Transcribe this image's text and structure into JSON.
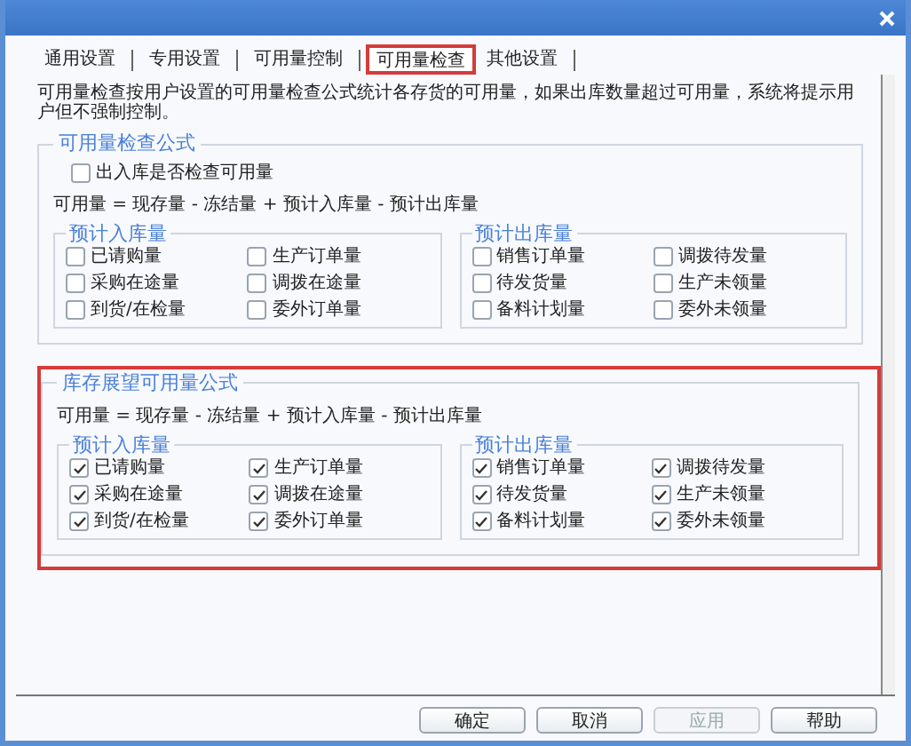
{
  "tabs": [
    {
      "label": "通用设置",
      "selected": false
    },
    {
      "label": "专用设置",
      "selected": false
    },
    {
      "label": "可用量控制",
      "selected": false
    },
    {
      "label": "可用量检查",
      "selected": true
    },
    {
      "label": "其他设置",
      "selected": false
    }
  ],
  "description": "可用量检查按用户设置的可用量检查公式统计各存货的可用量，如果出库数量超过可用量，系统将提示用户但不强制控制。",
  "sections": [
    {
      "title": "可用量检查公式",
      "highlighted": false,
      "checkbox": {
        "label": "出入库是否检查可用量",
        "checked": false
      },
      "formula": "可用量 = 现存量 - 冻结量 + 预计入库量 - 预计出库量",
      "groups": [
        {
          "title": "预计入库量",
          "items": [
            {
              "label": "已请购量",
              "checked": false
            },
            {
              "label": "生产订单量",
              "checked": false
            },
            {
              "label": "采购在途量",
              "checked": false
            },
            {
              "label": "调拨在途量",
              "checked": false
            },
            {
              "label": "到货/在检量",
              "checked": false
            },
            {
              "label": "委外订单量",
              "checked": false
            }
          ]
        },
        {
          "title": "预计出库量",
          "items": [
            {
              "label": "销售订单量",
              "checked": false
            },
            {
              "label": "调拨待发量",
              "checked": false
            },
            {
              "label": "待发货量",
              "checked": false
            },
            {
              "label": "生产未领量",
              "checked": false
            },
            {
              "label": "备料计划量",
              "checked": false
            },
            {
              "label": "委外未领量",
              "checked": false
            }
          ]
        }
      ]
    },
    {
      "title": "库存展望可用量公式",
      "highlighted": true,
      "formula": "可用量 = 现存量 - 冻结量 + 预计入库量 - 预计出库量",
      "groups": [
        {
          "title": "预计入库量",
          "items": [
            {
              "label": "已请购量",
              "checked": true
            },
            {
              "label": "生产订单量",
              "checked": true
            },
            {
              "label": "采购在途量",
              "checked": true
            },
            {
              "label": "调拨在途量",
              "checked": true
            },
            {
              "label": "到货/在检量",
              "checked": true
            },
            {
              "label": "委外订单量",
              "checked": true
            }
          ]
        },
        {
          "title": "预计出库量",
          "items": [
            {
              "label": "销售订单量",
              "checked": true
            },
            {
              "label": "调拨待发量",
              "checked": true
            },
            {
              "label": "待发货量",
              "checked": true
            },
            {
              "label": "生产未领量",
              "checked": true
            },
            {
              "label": "备料计划量",
              "checked": true
            },
            {
              "label": "委外未领量",
              "checked": true
            }
          ]
        }
      ]
    }
  ],
  "buttons": [
    {
      "label": "确定",
      "disabled": false
    },
    {
      "label": "取消",
      "disabled": false
    },
    {
      "label": "应用",
      "disabled": true
    },
    {
      "label": "帮助",
      "disabled": false
    }
  ]
}
